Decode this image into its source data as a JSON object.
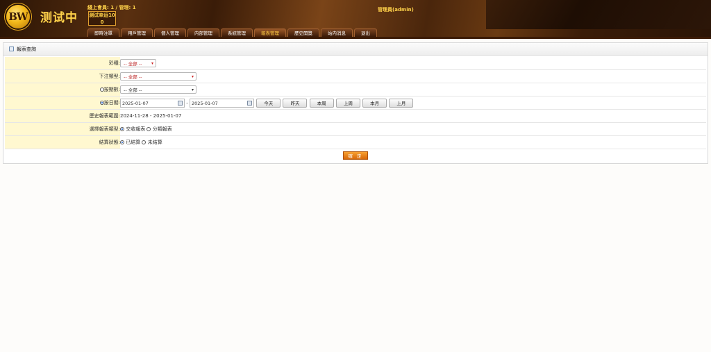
{
  "header": {
    "logo_text": "BW",
    "site_title": "测试中",
    "stats": "綫上會員: 1 / 管理: 1",
    "badge_line1": "测试幸运10",
    "badge_line2": "0",
    "admin": "管理員(admin)"
  },
  "nav": [
    {
      "label": "即時注單"
    },
    {
      "label": "用戶管理"
    },
    {
      "label": "個人管理"
    },
    {
      "label": "内部管理"
    },
    {
      "label": "系統管理"
    },
    {
      "label": "報表管理",
      "active": true
    },
    {
      "label": "歷史開獎"
    },
    {
      "label": "站内消息"
    },
    {
      "label": "退出"
    }
  ],
  "panel": {
    "title": "報表查詢",
    "rows": {
      "lottery_label": "彩種:",
      "lottery_value": "-- 全部 --",
      "bettype_label": "下注類型:",
      "bettype_value": "-- 全部 --",
      "period_label": "按期數:",
      "period_value": "-- 全部 --",
      "date_label": "按日期:",
      "date_from": "2025-01-07",
      "date_sep": "-",
      "date_to": "2025-01-07",
      "date_buttons": [
        "今天",
        "昨天",
        "本周",
        "上周",
        "本月",
        "上月"
      ],
      "range_label": "歷史報表範圍:",
      "range_value": "2024-11-28 - 2025-01-07",
      "report_type_label": "選擇報表類型:",
      "report_type_opt1": "交收報表",
      "report_type_opt2": "分類報表",
      "settle_label": "結算狀態:",
      "settle_opt1": "已結算",
      "settle_opt2": "未結算"
    },
    "submit_label": "確 定"
  },
  "colors": {
    "label_bg": "#fff8d0",
    "header_gold": "#ffd24a",
    "submit_orange": "#e8800f"
  }
}
